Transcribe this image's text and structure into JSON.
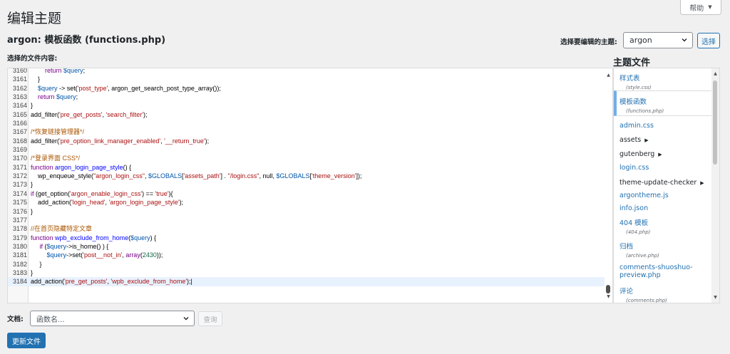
{
  "help_tab": {
    "label": "帮助",
    "caret": "▼"
  },
  "page_title": "编辑主题",
  "file_title": {
    "theme": "argon:",
    "name": "模板函数",
    "file": "(functions.php)"
  },
  "theme_selector": {
    "label": "选择要编辑的主题:",
    "value": "argon",
    "button": "选择"
  },
  "content_label": "选择的文件内容:",
  "editor": {
    "lines": [
      {
        "n": "3160",
        "html": "        <span class=\"kw\">return</span> <span class=\"var\">$query</span>;"
      },
      {
        "n": "3161",
        "html": "    }"
      },
      {
        "n": "3162",
        "html": "    <span class=\"var\">$query</span> -> set(<span class=\"str\">'post_type'</span>, argon_get_search_post_type_array());"
      },
      {
        "n": "3163",
        "html": "    <span class=\"kw\">return</span> <span class=\"var\">$query</span>;"
      },
      {
        "n": "3164",
        "html": "}"
      },
      {
        "n": "3165",
        "html": "add_filter(<span class=\"str\">'pre_get_posts'</span>, <span class=\"str\">'search_filter'</span>);"
      },
      {
        "n": "3166",
        "html": ""
      },
      {
        "n": "3167",
        "html": "<span class=\"cm\">/*恢复链接管理器*/</span>"
      },
      {
        "n": "3168",
        "html": "add_filter(<span class=\"str\">'pre_option_link_manager_enabled'</span>, <span class=\"str\">'__return_true'</span>);"
      },
      {
        "n": "3169",
        "html": ""
      },
      {
        "n": "3170",
        "html": "<span class=\"cm\">/*登录界面 CSS*/</span>"
      },
      {
        "n": "3171",
        "html": "<span class=\"kw\">function</span> <span class=\"def\">argon_login_page_style</span>() {"
      },
      {
        "n": "3172",
        "html": "    wp_enqueue_style(<span class=\"str\">\"argon_login_css\"</span>, <span class=\"var\">$GLOBALS</span>[<span class=\"str\">'assets_path'</span>] . <span class=\"str\">\"/login.css\"</span>, null, <span class=\"var\">$GLOBALS</span>[<span class=\"str\">'theme_version'</span>]);"
      },
      {
        "n": "3173",
        "html": "}"
      },
      {
        "n": "3174",
        "html": "<span class=\"kw\">if</span> (get_option(<span class=\"str\">'argon_enable_login_css'</span>) == <span class=\"str\">'true'</span>){"
      },
      {
        "n": "3175",
        "html": "    add_action(<span class=\"str\">'login_head'</span>, <span class=\"str\">'argon_login_page_style'</span>);"
      },
      {
        "n": "3176",
        "html": "}"
      },
      {
        "n": "3177",
        "html": ""
      },
      {
        "n": "3178",
        "html": "<span class=\"cm\">//在首页隐藏特定文章</span>"
      },
      {
        "n": "3179",
        "html": "<span class=\"kw\">function</span> <span class=\"def\">wpb_exclude_from_home</span>(<span class=\"var\">$query</span>) {"
      },
      {
        "n": "3180",
        "html": "     <span class=\"kw\">if</span> (<span class=\"var\">$query</span>->is_home() ) {"
      },
      {
        "n": "3181",
        "html": "         <span class=\"var\">$query</span>->set(<span class=\"str\">'post__not_in'</span>, <span class=\"kw\">array</span>(<span class=\"num\">2430</span>));"
      },
      {
        "n": "3182",
        "html": "     }"
      },
      {
        "n": "3183",
        "html": "}"
      },
      {
        "n": "3184",
        "html": "add_action(<span class=\"str\">'pre_get_posts'</span>, <span class=\"str\">'wpb_exclude_from_home'</span>);|"
      }
    ]
  },
  "sidebar": {
    "title": "主题文件",
    "items": [
      {
        "label": "样式表",
        "sub": "(style.css)"
      },
      {
        "label": "模板函数",
        "sub": "(functions.php)"
      },
      {
        "label": "admin.css"
      },
      {
        "label": "assets",
        "tri": "▶"
      },
      {
        "label": "gutenberg",
        "tri": "▶"
      },
      {
        "label": "login.css"
      },
      {
        "label": "theme-update-checker",
        "tri": "▶"
      },
      {
        "label": "argontheme.js"
      },
      {
        "label": "info.json"
      },
      {
        "label": "404 模板",
        "sub": "(404.php)"
      },
      {
        "label": "归档",
        "sub": "(archive.php)"
      },
      {
        "label": "comments-shuoshuo-"
      },
      {
        "label": "preview.php"
      },
      {
        "label": "评论",
        "sub": "(comments.php)"
      }
    ]
  },
  "doc_lookup": {
    "label": "文档:",
    "placeholder": "函数名...",
    "button": "查询"
  },
  "update_button": "更新文件"
}
